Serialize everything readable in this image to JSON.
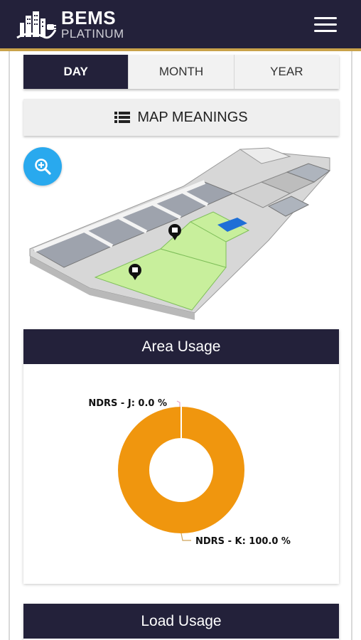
{
  "header": {
    "brand_title": "BEMS",
    "brand_subtitle": "PLATINUM"
  },
  "tabs": [
    {
      "label": "DAY",
      "active": true
    },
    {
      "label": "MONTH",
      "active": false
    },
    {
      "label": "YEAR",
      "active": false
    }
  ],
  "map_meanings": {
    "label": "MAP MEANINGS",
    "icon": "list-icon"
  },
  "zoom": {
    "icon": "zoom-in-icon"
  },
  "area_usage": {
    "title": "Area Usage",
    "labels": [
      "NDRS - J: 0.0 %",
      "NDRS - K: 100.0 %"
    ]
  },
  "load_usage": {
    "title": "Load Usage"
  },
  "colors": {
    "header_bg": "#23213a",
    "gold_accent": "#c9a24a",
    "zoom_blue": "#29a9ee",
    "slice_orange": "#f0960e",
    "area_green": "#c8ef9c"
  },
  "chart_data": {
    "type": "pie",
    "donut": true,
    "title": "Area Usage",
    "categories": [
      "NDRS - J",
      "NDRS - K"
    ],
    "values": [
      0.0,
      100.0
    ],
    "unit": "%",
    "colors": [
      "#e7a3c8",
      "#f0960e"
    ]
  }
}
